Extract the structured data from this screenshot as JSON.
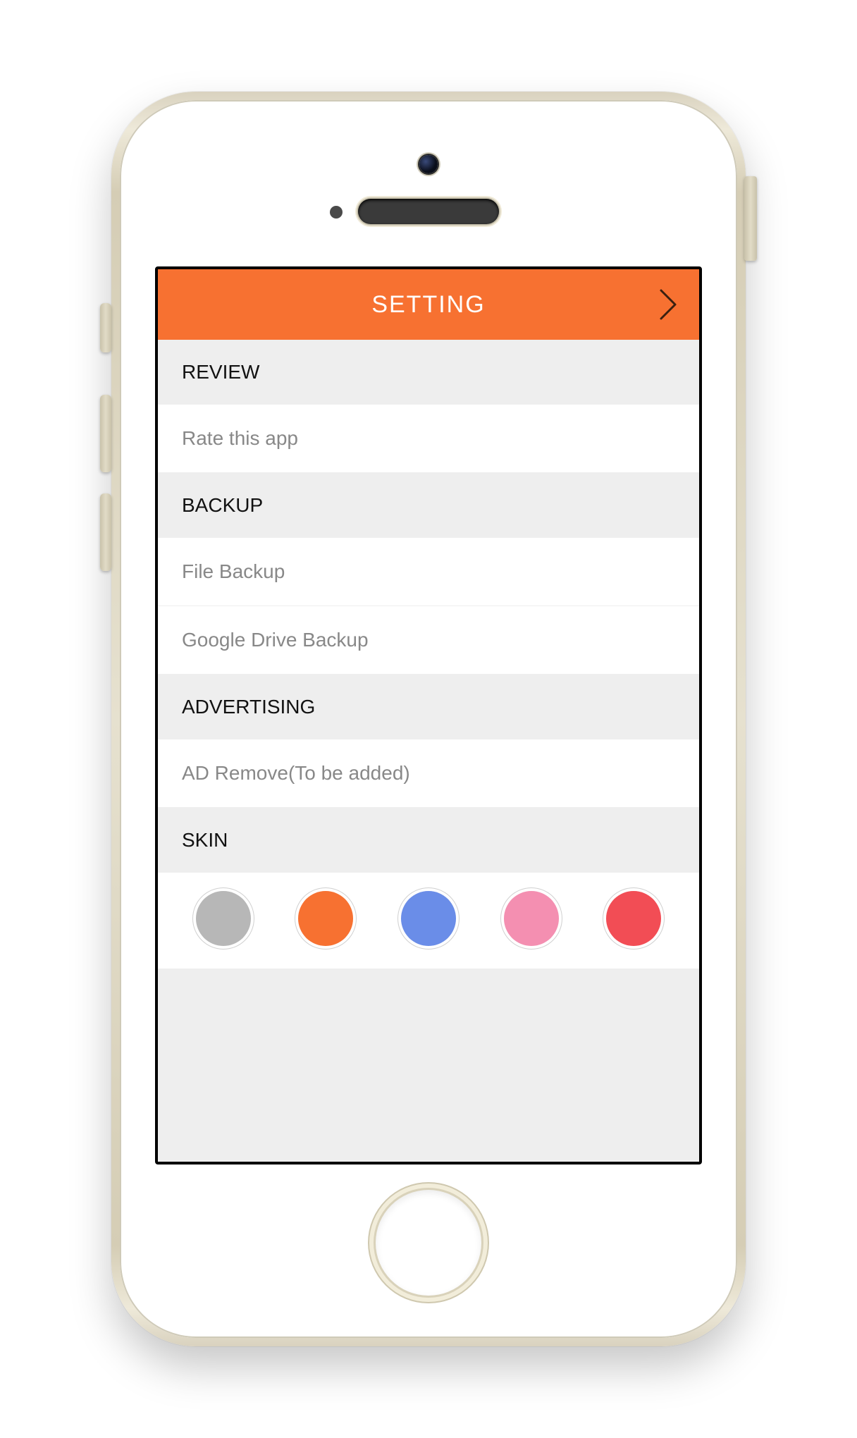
{
  "header": {
    "title": "SETTING"
  },
  "sections": {
    "review": {
      "heading": "REVIEW",
      "items": [
        "Rate this app"
      ]
    },
    "backup": {
      "heading": "BACKUP",
      "items": [
        "File Backup",
        "Google Drive Backup"
      ]
    },
    "advertising": {
      "heading": "ADVERTISING",
      "items": [
        "AD Remove(To be added)"
      ]
    },
    "skin": {
      "heading": "SKIN",
      "colors": [
        "#b7b7b7",
        "#f77131",
        "#6a8de8",
        "#f48fb1",
        "#f24d55"
      ]
    }
  },
  "accent_color": "#f77131"
}
